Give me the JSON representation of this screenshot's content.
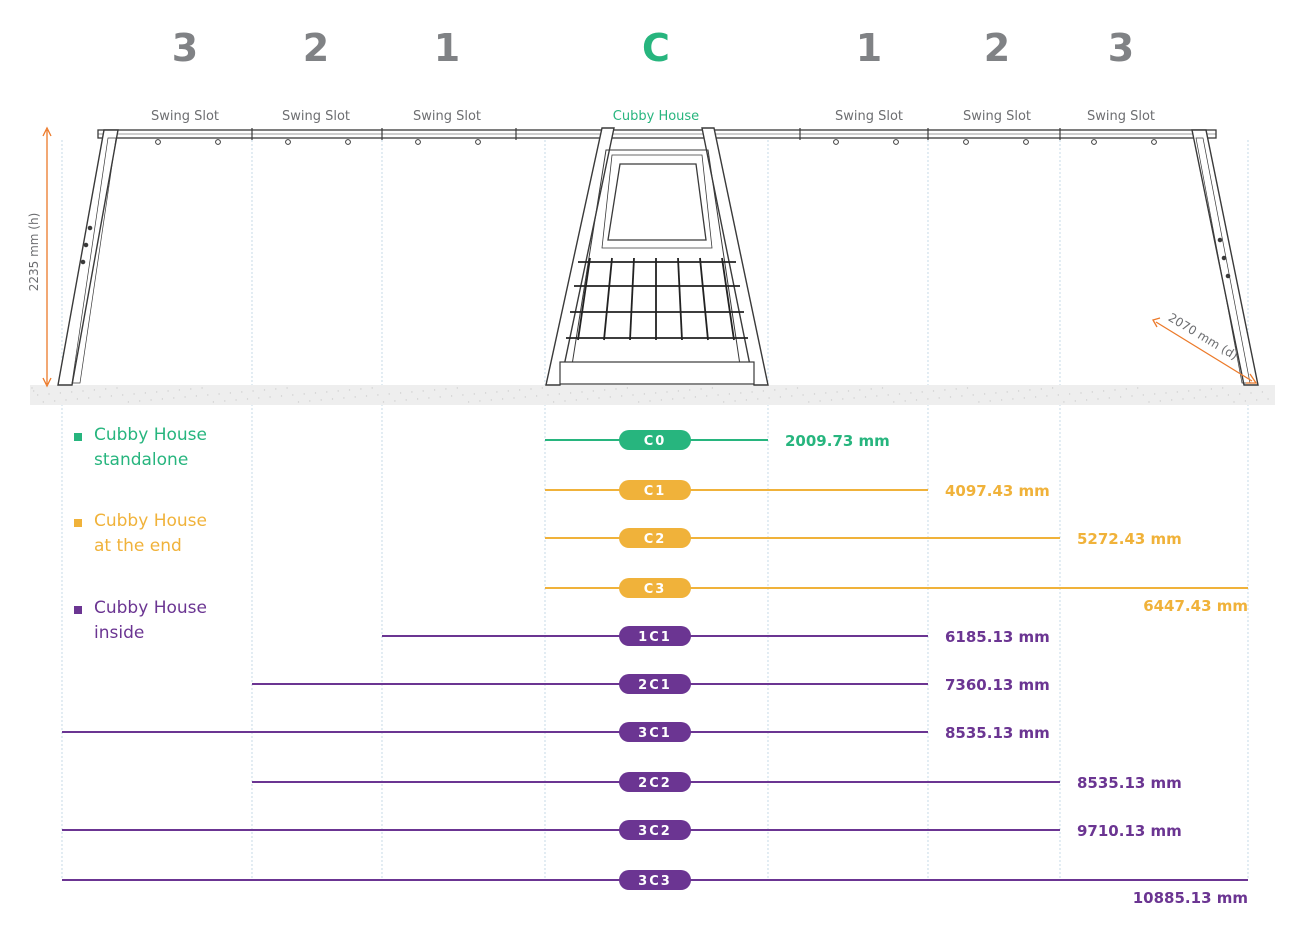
{
  "colors": {
    "green": "#27b57e",
    "orange": "#f0b23a",
    "purple": "#6b3592",
    "gray_heading": "#808285",
    "slot_label": "#6d6e71",
    "dim_arrow": "#ec7a2a",
    "guide": "#b9d2e2",
    "frame": "#3a3a3a"
  },
  "headings": [
    {
      "text": "3",
      "color": "gray"
    },
    {
      "text": "2",
      "color": "gray"
    },
    {
      "text": "1",
      "color": "gray"
    },
    {
      "text": "C",
      "color": "green"
    },
    {
      "text": "1",
      "color": "gray"
    },
    {
      "text": "2",
      "color": "gray"
    },
    {
      "text": "3",
      "color": "gray"
    }
  ],
  "slot_labels": [
    {
      "text": "Swing Slot",
      "color": "gray"
    },
    {
      "text": "Swing Slot",
      "color": "gray"
    },
    {
      "text": "Swing Slot",
      "color": "gray"
    },
    {
      "text": "Cubby House",
      "color": "green"
    },
    {
      "text": "Swing Slot",
      "color": "gray"
    },
    {
      "text": "Swing Slot",
      "color": "gray"
    },
    {
      "text": "Swing Slot",
      "color": "gray"
    }
  ],
  "dimensions": {
    "height_label": "2235 mm (h)",
    "depth_label": "2070 mm (d)"
  },
  "legend": [
    {
      "line1": "Cubby House",
      "line2": "standalone",
      "color": "green"
    },
    {
      "line1": "Cubby House",
      "line2": "at the end",
      "color": "orange"
    },
    {
      "line1": "Cubby House",
      "line2": "inside",
      "color": "purple"
    }
  ],
  "configurations": [
    {
      "code": "C0",
      "length": "2009.73 mm",
      "color": "green",
      "span": [
        "C-left",
        "C-right"
      ]
    },
    {
      "code": "C1",
      "length": "4097.43 mm",
      "color": "orange",
      "span": [
        "C-left",
        "R1"
      ]
    },
    {
      "code": "C2",
      "length": "5272.43 mm",
      "color": "orange",
      "span": [
        "C-left",
        "R2"
      ]
    },
    {
      "code": "C3",
      "length": "6447.43 mm",
      "color": "orange",
      "span": [
        "C-left",
        "R3"
      ]
    },
    {
      "code": "1C1",
      "length": "6185.13 mm",
      "color": "purple",
      "span": [
        "L1",
        "R1"
      ]
    },
    {
      "code": "2C1",
      "length": "7360.13 mm",
      "color": "purple",
      "span": [
        "L2",
        "R1"
      ]
    },
    {
      "code": "3C1",
      "length": "8535.13 mm",
      "color": "purple",
      "span": [
        "L3",
        "R1"
      ]
    },
    {
      "code": "2C2",
      "length": "8535.13 mm",
      "color": "purple",
      "span": [
        "L2",
        "R2"
      ]
    },
    {
      "code": "3C2",
      "length": "9710.13 mm",
      "color": "purple",
      "span": [
        "L3",
        "R2"
      ]
    },
    {
      "code": "3C3",
      "length": "10885.13 mm",
      "color": "purple",
      "span": [
        "L3",
        "R3"
      ]
    }
  ]
}
